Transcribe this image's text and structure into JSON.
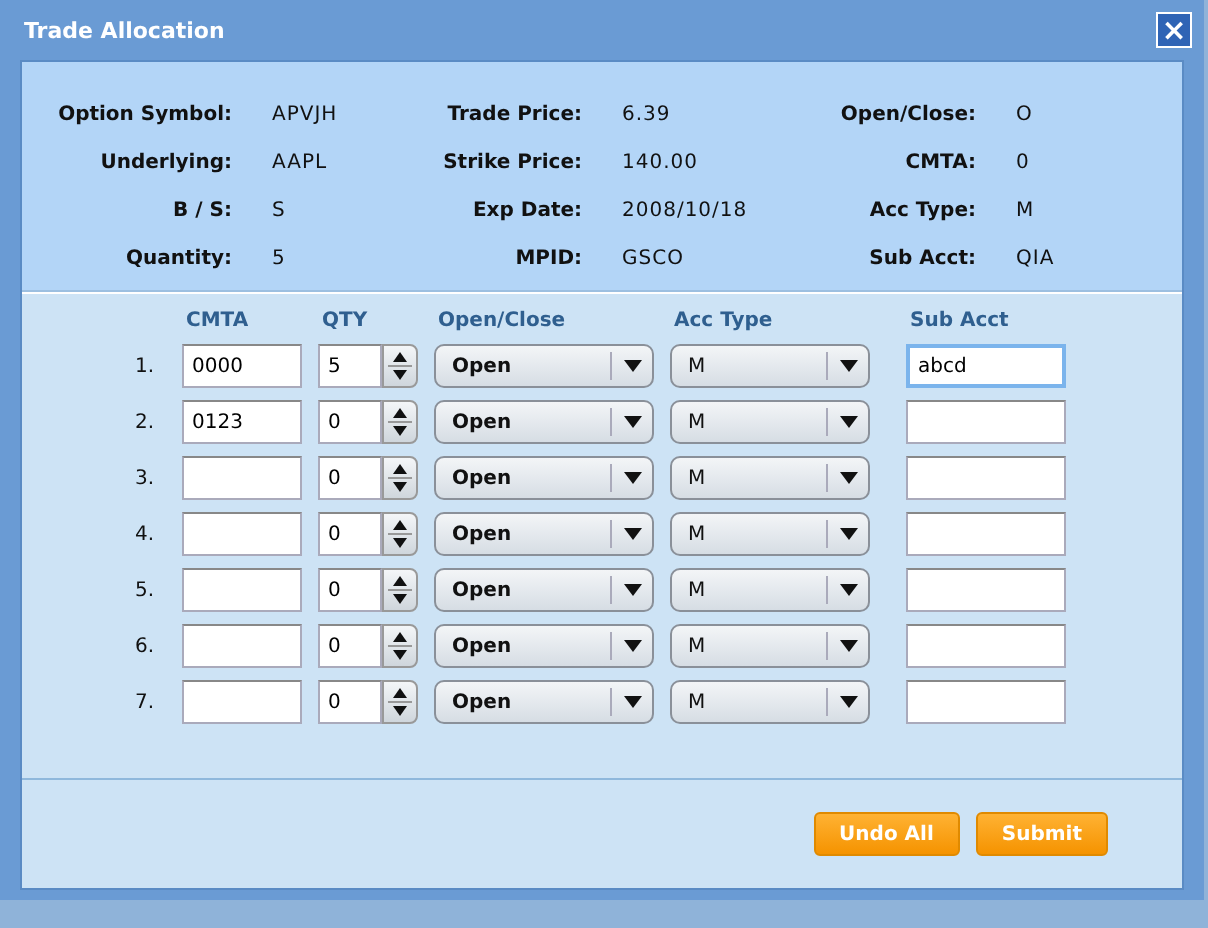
{
  "window": {
    "title": "Trade Allocation",
    "close_label": "×"
  },
  "summary": [
    {
      "label": "Option Symbol:",
      "value": "APVJH"
    },
    {
      "label": "Trade Price:",
      "value": "6.39"
    },
    {
      "label": "Open/Close:",
      "value": "O"
    },
    {
      "label": "Underlying:",
      "value": "AAPL"
    },
    {
      "label": "Strike Price:",
      "value": "140.00"
    },
    {
      "label": "CMTA:",
      "value": "0"
    },
    {
      "label": "B / S:",
      "value": "S"
    },
    {
      "label": "Exp Date:",
      "value": "2008/10/18"
    },
    {
      "label": "Acc Type:",
      "value": "M"
    },
    {
      "label": "Quantity:",
      "value": "5"
    },
    {
      "label": "MPID:",
      "value": "GSCO"
    },
    {
      "label": "Sub Acct:",
      "value": "QIA"
    }
  ],
  "allocation": {
    "columns": [
      "CMTA",
      "QTY",
      "Open/Close",
      "Acc Type",
      "Sub Acct"
    ],
    "rows": [
      {
        "number": "1.",
        "cmta": "0000",
        "qty": "5",
        "open_close": "Open",
        "acc_type": "M",
        "sub_acct": "abcd",
        "focused": true
      },
      {
        "number": "2.",
        "cmta": "0123",
        "qty": "0",
        "open_close": "Open",
        "acc_type": "M",
        "focused": false
      },
      {
        "number": "3.",
        "qty": "0",
        "open_close": "Open",
        "acc_type": "M",
        "focused": false
      },
      {
        "number": "4.",
        "qty": "0",
        "open_close": "Open",
        "acc_type": "M",
        "focused": false
      },
      {
        "number": "5.",
        "qty": "0",
        "open_close": "Open",
        "acc_type": "M",
        "focused": false
      },
      {
        "number": "6.",
        "qty": "0",
        "open_close": "Open",
        "acc_type": "M",
        "focused": false
      },
      {
        "number": "7.",
        "qty": "0",
        "open_close": "Open",
        "acc_type": "M",
        "focused": false
      }
    ]
  },
  "buttons": [
    "Undo All",
    "Submit"
  ]
}
